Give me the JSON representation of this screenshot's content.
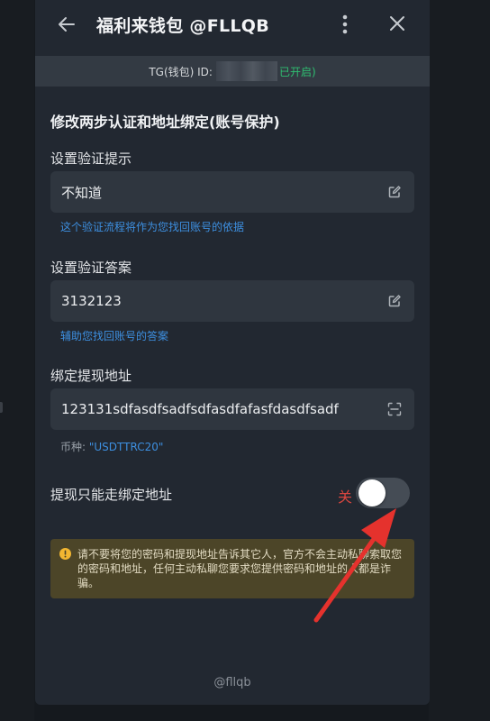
{
  "header": {
    "title": "福利来钱包 @FLLQB"
  },
  "tgbar": {
    "prefix": "TG(钱包) ID:",
    "status": "已开启)"
  },
  "page": {
    "section_title": "修改两步认证和地址绑定(账号保护)"
  },
  "fields": {
    "hint_question": {
      "label": "设置验证提示",
      "value": "不知道",
      "helper": "这个验证流程将作为您找回账号的依据"
    },
    "answer": {
      "label": "设置验证答案",
      "value": "3132123",
      "helper": "辅助您找回账号的答案"
    },
    "address": {
      "label": "绑定提现地址",
      "value": "123131sdfasdfsadfsdfasdfafasfdasdfsadf",
      "currency_label": "币种:",
      "currency_value": "\"USDTTRC20\""
    }
  },
  "toggle": {
    "label": "提现只能走绑定地址",
    "state_text": "关",
    "enabled": false
  },
  "warning": {
    "text": "请不要将您的密码和提现地址告诉其它人，官方不会主动私聊索取您的密码和地址，任何主动私聊您要求您提供密码和地址的人都是诈骗。"
  },
  "footer": {
    "handle": "@fllqb"
  },
  "icons": {
    "back": "arrow-left-icon",
    "more": "more-vertical-icon",
    "close": "close-icon",
    "edit": "edit-icon",
    "scan": "scan-icon",
    "warning": "warning-icon"
  },
  "colors": {
    "link": "#3d8fe0",
    "status_on": "#2fbf71",
    "toggle_off_text": "#d9463f",
    "warning_bg": "#4c4528",
    "annotation_arrow": "#e5322d"
  }
}
